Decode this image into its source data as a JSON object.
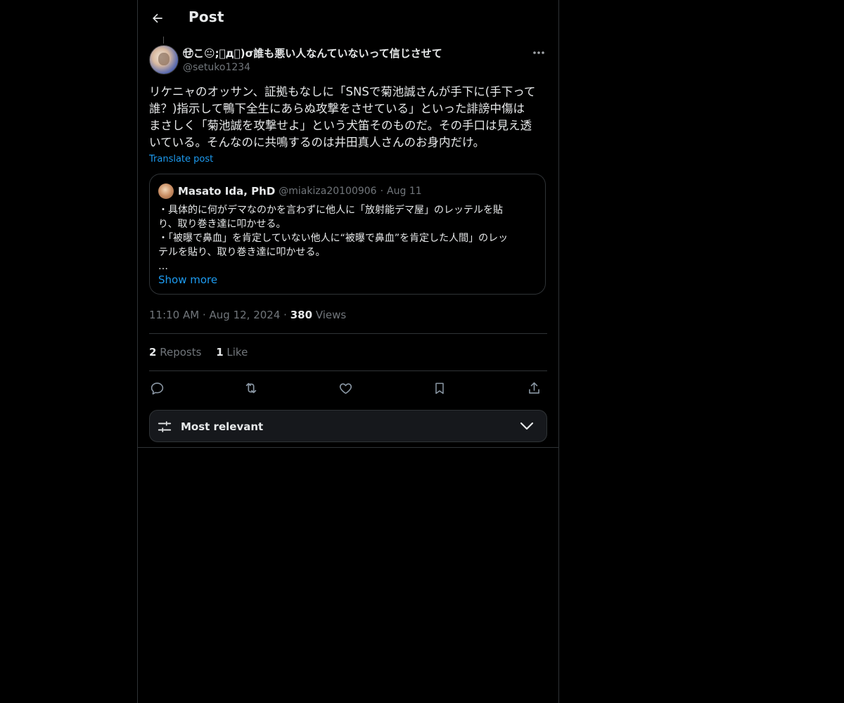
{
  "header": {
    "title": "Post",
    "back_icon": "arrow-left-icon"
  },
  "post": {
    "display_name": "せ⃝こ😐;゚д゚)σ誰も悪い人なんていないって信じさせて",
    "handle": "@setuko1234",
    "body": "リケニャのオッサン、証拠もなしに「SNSで菊池誠さんが手下に(手下って\n誰？)指示して鴨下全生にあらぬ攻撃をさせている」といった誹謗中傷は\nまさしく「菊池誠を攻撃せよ」という犬笛そのものだ。その手口は見え透\nいている。そんなのに共鳴するのは井田真人さんのお身内だけ。",
    "translate_label": "Translate post",
    "time": "11:10 AM",
    "date": "Aug 12, 2024",
    "views_count": "380",
    "views_label": "Views",
    "reposts_count": "2",
    "reposts_label": "Reposts",
    "likes_count": "1",
    "likes_label": "Like"
  },
  "quote": {
    "name": "Masato Ida, PhD",
    "handle": "@miakiza20100906",
    "date": "Aug 11",
    "lines": [
      "・具体的に何がデマなのかを言わずに他人に「放射能デマ屋」のレッテルを貼",
      "り、取り巻き達に叩かせる。",
      "・「被曝で鼻血」を肯定していない他人に“被曝で鼻血”を肯定した人間」のレッ",
      "テルを貼り、取り巻き達に叩かせる。",
      "…"
    ],
    "show_more": "Show more"
  },
  "sort": {
    "label": "Most relevant"
  },
  "colors": {
    "accent": "#1d9bf0",
    "text": "#e7e9ea",
    "muted": "#71767b",
    "border": "#2f3336",
    "background": "#000000"
  }
}
